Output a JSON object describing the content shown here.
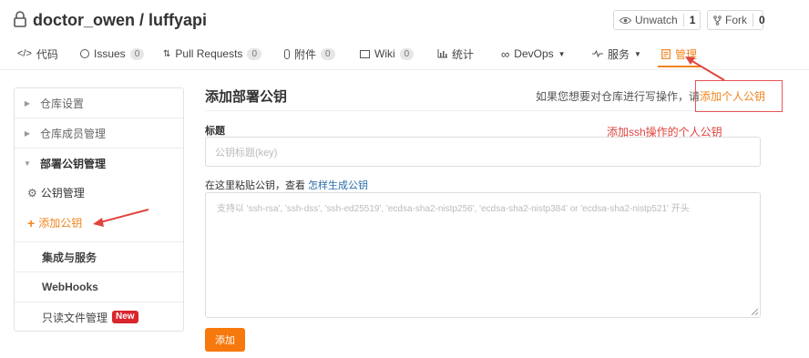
{
  "header": {
    "title": "doctor_owen / luffyapi",
    "watch_label": "Unwatch",
    "watch_count": "1",
    "fork_label": "Fork",
    "fork_count": "0"
  },
  "tabs": [
    {
      "label": "代码",
      "icon": "code-icon"
    },
    {
      "label": "Issues",
      "badge": "0",
      "icon": "issue-icon"
    },
    {
      "label": "Pull Requests",
      "badge": "0",
      "icon": "pull-request-icon"
    },
    {
      "label": "附件",
      "badge": "0",
      "icon": "attachment-icon"
    },
    {
      "label": "Wiki",
      "badge": "0",
      "icon": "wiki-icon"
    },
    {
      "label": "统计",
      "icon": "chart-icon"
    },
    {
      "label": "DevOps",
      "icon": "devops-icon"
    },
    {
      "label": "服务",
      "icon": "pulse-icon"
    },
    {
      "label": "管理",
      "icon": "manage-icon"
    }
  ],
  "sidebar": {
    "items": [
      {
        "label": "仓库设置"
      },
      {
        "label": "仓库成员管理"
      },
      {
        "label": "部署公钥管理"
      },
      {
        "label": "公钥管理"
      },
      {
        "label": "添加公钥"
      },
      {
        "label": "集成与服务"
      },
      {
        "label": "WebHooks"
      },
      {
        "label": "只读文件管理",
        "badge": "New"
      }
    ]
  },
  "main": {
    "title": "添加部署公钥",
    "hint_text": "如果您想要对仓库进行写操作，请",
    "hint_link": "添加个人公钥",
    "title_label": "标题",
    "title_placeholder": "公钥标题(key)",
    "paste_label": "在这里粘贴公钥，查看",
    "paste_link": "怎样生成公钥",
    "key_placeholder": "支持以 'ssh-rsa', 'ssh-dss', 'ssh-ed25519', 'ecdsa-sha2-nistp256', 'ecdsa-sha2-nistp384' or 'ecdsa-sha2-nistp521' 开头",
    "submit_label": "添加"
  },
  "annotation": {
    "note": "添加ssh操作的个人公钥"
  },
  "colors": {
    "accent": "#f0841e",
    "button": "#f7780d",
    "annotation": "#e0443e",
    "link": "#2a6ba8"
  }
}
